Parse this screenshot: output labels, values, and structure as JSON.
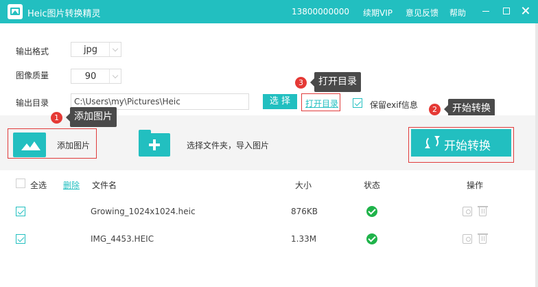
{
  "titlebar": {
    "title": "Heic图片转换精灵",
    "phone": "13800000000",
    "vip": "续期VIP",
    "feedback": "意见反馈",
    "help": "帮助",
    "bg_color": "#22bfc0"
  },
  "settings": {
    "format_label": "输出格式",
    "format_value": "jpg",
    "quality_label": "图像质量",
    "quality_value": "90",
    "dir_label": "输出目录",
    "dir_value": "C:\\Users\\my\\Pictures\\Heic",
    "choose_label": "选 择",
    "open_dir_label": "打开目录",
    "exif_label": "保留exif信息",
    "exif_checked": true
  },
  "tooltips": {
    "step1_num": "1",
    "step1_text": "添加图片",
    "step2_num": "2",
    "step2_text": "开始转换",
    "step3_num": "3",
    "step3_text": "打开目录"
  },
  "toolbar": {
    "add_label": "添加图片",
    "folder_label": "选择文件夹，导入图片",
    "start_label": "开始转换"
  },
  "table": {
    "select_all": "全选",
    "delete": "删除",
    "headers": {
      "name": "文件名",
      "size": "大小",
      "status": "状态",
      "action": "操作"
    },
    "rows": [
      {
        "name": "Growing_1024x1024.heic",
        "size": "876KB",
        "status": "ok-icon",
        "checked": true
      },
      {
        "name": "IMG_4453.HEIC",
        "size": "1.33M",
        "status": "ok-icon",
        "checked": true
      }
    ]
  },
  "colors": {
    "accent": "#22bfc0",
    "highlight": "#e03b3b",
    "success": "#1fb34a"
  }
}
